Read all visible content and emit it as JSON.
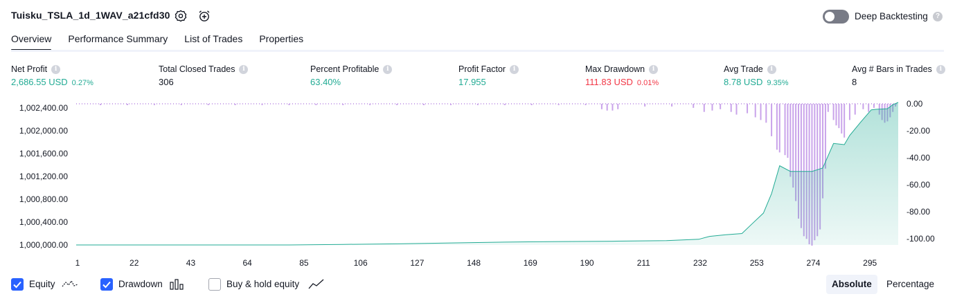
{
  "header": {
    "title": "Tuisku_TSLA_1d_1WAV_a21cfd30",
    "deep_backtesting_label": "Deep Backtesting",
    "deep_backtesting_on": false
  },
  "tabs": [
    {
      "label": "Overview",
      "active": true
    },
    {
      "label": "Performance Summary",
      "active": false
    },
    {
      "label": "List of Trades",
      "active": false
    },
    {
      "label": "Properties",
      "active": false
    }
  ],
  "metrics": [
    {
      "label": "Net Profit",
      "value": "2,686.55 USD",
      "sub": "0.27%",
      "tone": "green"
    },
    {
      "label": "Total Closed Trades",
      "value": "306",
      "sub": "",
      "tone": "dark"
    },
    {
      "label": "Percent Profitable",
      "value": "63.40%",
      "sub": "",
      "tone": "green"
    },
    {
      "label": "Profit Factor",
      "value": "17.955",
      "sub": "",
      "tone": "green"
    },
    {
      "label": "Max Drawdown",
      "value": "111.83 USD",
      "sub": "0.01%",
      "tone": "red"
    },
    {
      "label": "Avg Trade",
      "value": "8.78 USD",
      "sub": "9.35%",
      "tone": "green"
    },
    {
      "label": "Avg # Bars in Trades",
      "value": "8",
      "sub": "",
      "tone": "dark"
    }
  ],
  "chart_data": {
    "type": "area",
    "x_ticks": [
      "1",
      "22",
      "43",
      "64",
      "85",
      "106",
      "127",
      "148",
      "169",
      "190",
      "211",
      "232",
      "253",
      "274",
      "295"
    ],
    "xlim": [
      1,
      306
    ],
    "left_axis_ticks": [
      "1,000,000.00",
      "1,000,400.00",
      "1,000,800.00",
      "1,001,200.00",
      "1,001,600.00",
      "1,002,000.00",
      "1,002,400.00"
    ],
    "left_ylim": [
      1000000,
      1002500
    ],
    "right_axis_ticks": [
      "0.00",
      "-20.00",
      "-40.00",
      "-60.00",
      "-80.00",
      "-100.00"
    ],
    "right_ylim": [
      -105,
      0
    ],
    "colors": {
      "equity_line": "#22ab94",
      "equity_fill": "#d9f2ec",
      "drawdown": "#c9a3ea"
    },
    "equity": {
      "x": [
        1,
        20,
        40,
        60,
        80,
        100,
        120,
        140,
        160,
        180,
        200,
        220,
        232,
        236,
        242,
        248,
        252,
        256,
        259,
        262,
        266,
        270,
        274,
        278,
        282,
        286,
        288,
        292,
        296,
        298,
        302,
        304,
        306
      ],
      "y": [
        1000000,
        1000000,
        1000000,
        1000000,
        1000000,
        1000010,
        1000020,
        1000035,
        1000050,
        1000060,
        1000065,
        1000075,
        1000100,
        1000150,
        1000180,
        1000200,
        1000380,
        1000560,
        1000900,
        1001390,
        1001290,
        1001290,
        1001290,
        1001350,
        1001780,
        1001760,
        1001920,
        1002150,
        1002370,
        1002380,
        1002390,
        1002460,
        1002600
      ]
    },
    "drawdown": [
      {
        "x": 10,
        "y": -1
      },
      {
        "x": 20,
        "y": -1
      },
      {
        "x": 30,
        "y": -1
      },
      {
        "x": 40,
        "y": -1
      },
      {
        "x": 50,
        "y": -1
      },
      {
        "x": 60,
        "y": -1
      },
      {
        "x": 70,
        "y": -1
      },
      {
        "x": 80,
        "y": -1
      },
      {
        "x": 90,
        "y": -1
      },
      {
        "x": 100,
        "y": -1
      },
      {
        "x": 110,
        "y": -1
      },
      {
        "x": 120,
        "y": -1
      },
      {
        "x": 130,
        "y": -1
      },
      {
        "x": 140,
        "y": -1
      },
      {
        "x": 150,
        "y": -1
      },
      {
        "x": 160,
        "y": -1
      },
      {
        "x": 170,
        "y": -1
      },
      {
        "x": 180,
        "y": -1
      },
      {
        "x": 190,
        "y": -1
      },
      {
        "x": 196,
        "y": -4
      },
      {
        "x": 198,
        "y": -5
      },
      {
        "x": 200,
        "y": -5
      },
      {
        "x": 202,
        "y": -4
      },
      {
        "x": 212,
        "y": -2
      },
      {
        "x": 222,
        "y": -2
      },
      {
        "x": 230,
        "y": -3
      },
      {
        "x": 234,
        "y": -6
      },
      {
        "x": 237,
        "y": -5
      },
      {
        "x": 240,
        "y": -4
      },
      {
        "x": 244,
        "y": -6
      },
      {
        "x": 246,
        "y": -8
      },
      {
        "x": 250,
        "y": -7
      },
      {
        "x": 253,
        "y": -10
      },
      {
        "x": 255,
        "y": -12
      },
      {
        "x": 257,
        "y": -14
      },
      {
        "x": 259,
        "y": -24
      },
      {
        "x": 261,
        "y": -34
      },
      {
        "x": 262,
        "y": -36
      },
      {
        "x": 264,
        "y": -38
      },
      {
        "x": 265,
        "y": -40
      },
      {
        "x": 266,
        "y": -54
      },
      {
        "x": 267,
        "y": -62
      },
      {
        "x": 268,
        "y": -72
      },
      {
        "x": 269,
        "y": -85
      },
      {
        "x": 270,
        "y": -92
      },
      {
        "x": 271,
        "y": -98
      },
      {
        "x": 272,
        "y": -100
      },
      {
        "x": 273,
        "y": -104
      },
      {
        "x": 274,
        "y": -105
      },
      {
        "x": 275,
        "y": -101
      },
      {
        "x": 276,
        "y": -98
      },
      {
        "x": 277,
        "y": -93
      },
      {
        "x": 278,
        "y": -70
      },
      {
        "x": 279,
        "y": -48
      },
      {
        "x": 280,
        "y": -6
      },
      {
        "x": 282,
        "y": -12
      },
      {
        "x": 283,
        "y": -16
      },
      {
        "x": 284,
        "y": -18
      },
      {
        "x": 285,
        "y": -22
      },
      {
        "x": 286,
        "y": -25
      },
      {
        "x": 288,
        "y": -12
      },
      {
        "x": 290,
        "y": -8
      },
      {
        "x": 293,
        "y": -4
      },
      {
        "x": 295,
        "y": -6
      },
      {
        "x": 297,
        "y": -3
      },
      {
        "x": 299,
        "y": -8
      },
      {
        "x": 300,
        "y": -12
      },
      {
        "x": 301,
        "y": -14
      },
      {
        "x": 302,
        "y": -13
      },
      {
        "x": 303,
        "y": -10
      },
      {
        "x": 304,
        "y": -6
      },
      {
        "x": 305,
        "y": -2
      }
    ]
  },
  "legend": {
    "equity_label": "Equity",
    "equity_checked": true,
    "drawdown_label": "Drawdown",
    "drawdown_checked": true,
    "buyhold_label": "Buy & hold equity",
    "buyhold_checked": false
  },
  "scale_toggle": {
    "absolute_label": "Absolute",
    "percentage_label": "Percentage",
    "active": "Absolute"
  }
}
